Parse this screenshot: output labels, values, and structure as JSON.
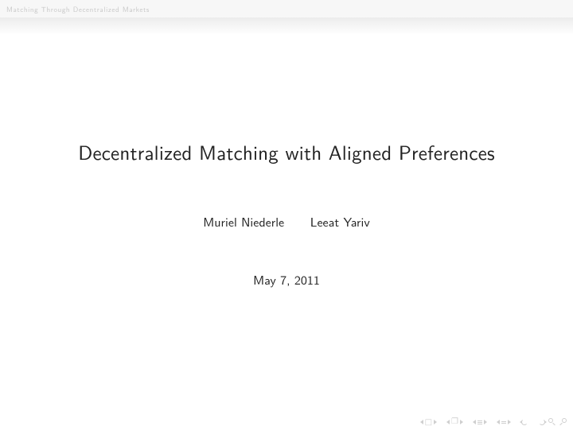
{
  "header": {
    "section": "Matching Through Decentralized Markets"
  },
  "title": "Decentralized Matching with Aligned Preferences",
  "authors": [
    "Muriel Niederle",
    "Leeat Yariv"
  ],
  "date": "May 7, 2011",
  "nav": {
    "frame_symbol": "□",
    "section_symbol": "❐",
    "slide_symbol": "≡"
  }
}
